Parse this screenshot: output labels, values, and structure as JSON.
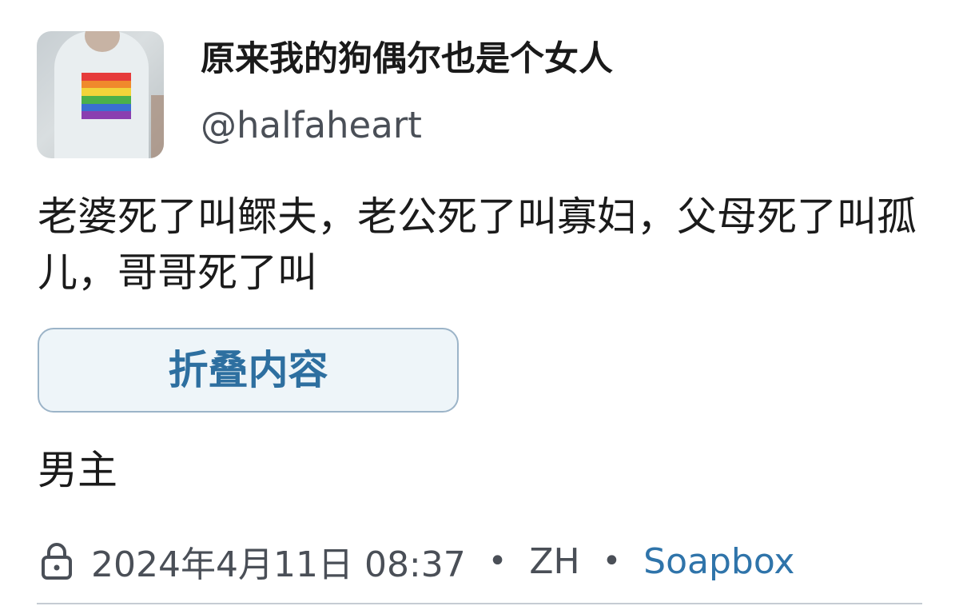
{
  "author": {
    "display_name": "原来我的狗偶尔也是个女人",
    "handle": "@halfaheart",
    "avatar_flag_colors": [
      "#e63b3b",
      "#f08a2c",
      "#f2d43a",
      "#4bb04a",
      "#3a6fd1",
      "#8a3fb0"
    ]
  },
  "post": {
    "text": "老婆死了叫鳏夫，老公死了叫寡妇，父母死了叫孤儿，哥哥死了叫",
    "collapse_label": "折叠内容",
    "hidden_text": "男主"
  },
  "meta": {
    "visibility_icon": "lock-icon",
    "timestamp": "2024年4月11日 08:37",
    "separator": "•",
    "language": "ZH",
    "app": "Soapbox",
    "accent_color": "#2f74aa"
  }
}
